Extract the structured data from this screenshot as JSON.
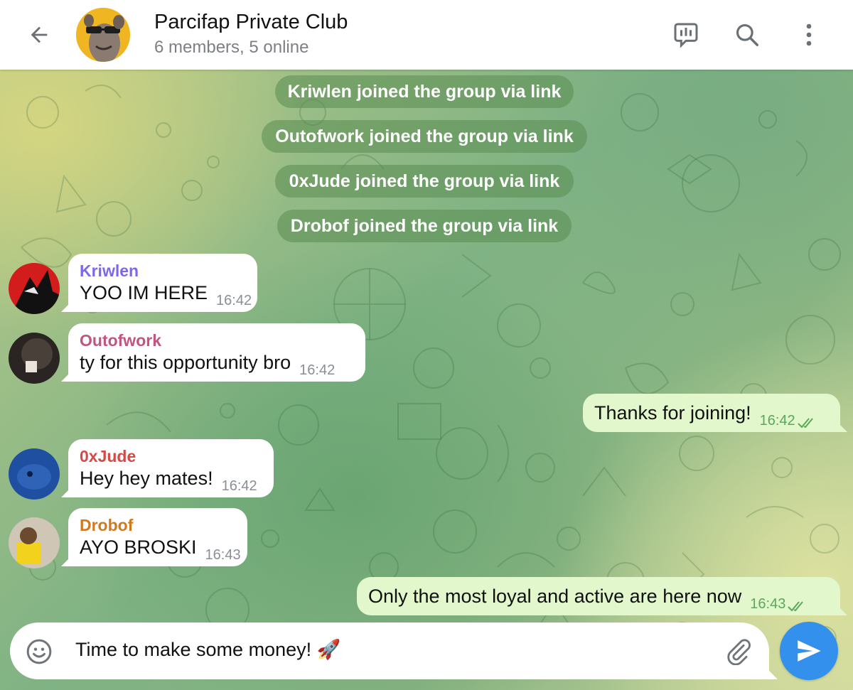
{
  "header": {
    "title": "Parcifap Private Club",
    "subtitle": "6 members, 5 online"
  },
  "service_messages": [
    {
      "text": "Kriwlen joined the group via link"
    },
    {
      "text": "Outofwork joined the group via link"
    },
    {
      "text": "0xJude joined the group via link"
    },
    {
      "text": "Drobof joined the group via link"
    }
  ],
  "messages": [
    {
      "sender": "Kriwlen",
      "sender_color": "#7b68ee",
      "text": "YOO IM HERE",
      "time": "16:42",
      "direction": "in"
    },
    {
      "sender": "Outofwork",
      "sender_color": "#c0567f",
      "text": "ty for this opportunity bro",
      "time": "16:42",
      "direction": "in"
    },
    {
      "text": "Thanks for joining!",
      "time": "16:42",
      "direction": "out",
      "status": "read"
    },
    {
      "sender": "0xJude",
      "sender_color": "#d24b46",
      "text": "Hey hey mates!",
      "time": "16:42",
      "direction": "in"
    },
    {
      "sender": "Drobof",
      "sender_color": "#d07a1f",
      "text": "AYO BROSKI",
      "time": "16:43",
      "direction": "in"
    },
    {
      "text": "Only the most loyal and active are here now",
      "time": "16:43",
      "direction": "out",
      "status": "read"
    }
  ],
  "composer": {
    "text": "Time to make some money! 🚀"
  },
  "colors": {
    "accent": "#3390ec",
    "outgoing_bubble": "#e2f7cb",
    "read_ticks": "#5aa85a"
  },
  "icons": {
    "back": "arrow-left-icon",
    "video_chat": "live-stream-icon",
    "search": "search-icon",
    "menu": "more-vertical-icon",
    "emoji": "smile-icon",
    "attach": "paperclip-icon",
    "send": "send-icon"
  }
}
